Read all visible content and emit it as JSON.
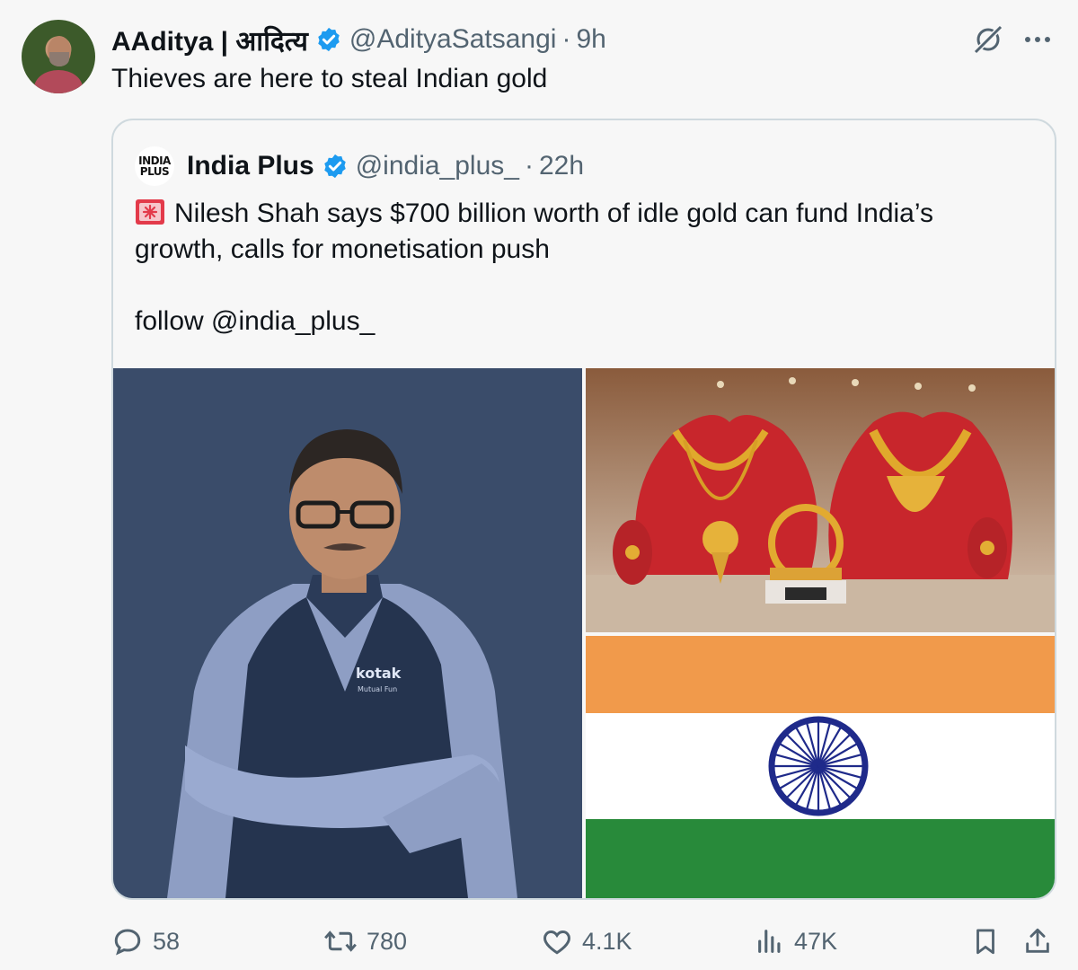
{
  "tweet": {
    "author_name": "AAditya | आदित्य",
    "handle": "@AdityaSatsangi",
    "separator": "·",
    "time": "9h",
    "text": "Thieves are here to steal Indian gold"
  },
  "quoted": {
    "logo_text_line1": "INDIA",
    "logo_text_line2": "PLUS",
    "author_name": "India Plus",
    "handle": "@india_plus_",
    "separator": "·",
    "time": "22h",
    "text_line1": "Nilesh Shah says $700 billion worth of idle gold can fund India’s",
    "text_line2": "growth, calls for monetisation push",
    "text_line3": "follow @india_plus_",
    "image_brand_text": "kotak",
    "image_brand_sub": "Mutual Fun"
  },
  "actions": {
    "replies": "58",
    "reposts": "780",
    "likes": "4.1K",
    "views": "47K"
  },
  "colors": {
    "verified": "#1d9bf0",
    "secondary_text": "#536471",
    "flag_saffron": "#f19a4b",
    "flag_green": "#288a3a",
    "chakra": "#1f2a8a"
  },
  "icons": [
    "verified-badge-icon",
    "grok-icon",
    "more-icon",
    "siren-icon",
    "reply-icon",
    "repost-icon",
    "like-icon",
    "views-icon",
    "bookmark-icon",
    "share-icon"
  ]
}
